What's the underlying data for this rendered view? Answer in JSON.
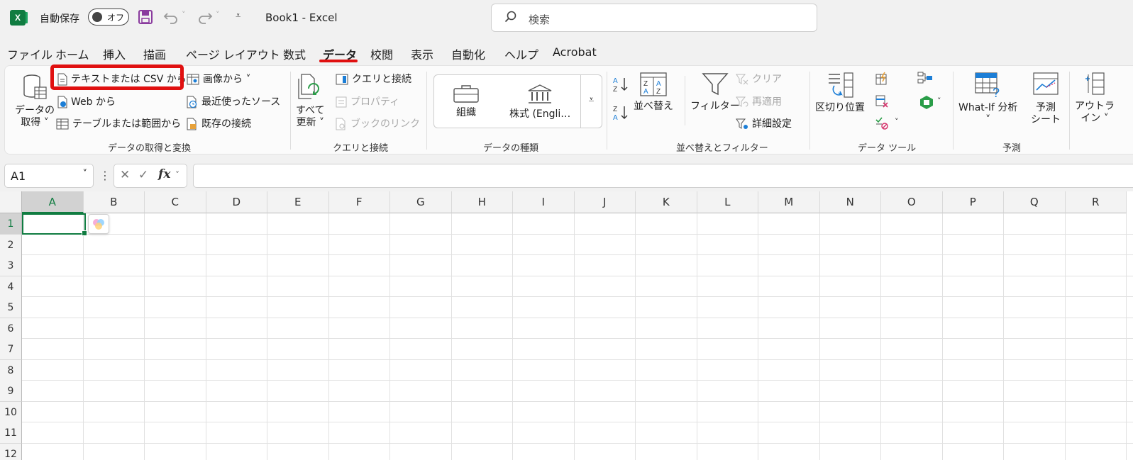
{
  "titlebar": {
    "logo": "X",
    "autosave_label": "自動保存",
    "autosave_state": "オフ",
    "doc_title": "Book1  -  Excel",
    "search_placeholder": "検索"
  },
  "menu": {
    "tabs": [
      "ファイル",
      "ホーム",
      "挿入",
      "描画",
      "ページ レイアウト",
      "数式",
      "データ",
      "校閲",
      "表示",
      "自動化",
      "ヘルプ",
      "Acrobat"
    ],
    "active": "データ"
  },
  "ribbon": {
    "get_transform": {
      "label": "データの取得と変換",
      "get_data": [
        "データの",
        "取得 ˅"
      ],
      "from_text_csv": "テキストまたは CSV から",
      "from_web": "Web から",
      "from_table": "テーブルまたは範囲から",
      "from_picture": "画像から ˅",
      "recent_sources": "最近使ったソース",
      "existing_connections": "既存の接続"
    },
    "queries": {
      "label": "クエリと接続",
      "refresh_all": [
        "すべて",
        "更新 ˅"
      ],
      "queries_connections": "クエリと接続",
      "properties": "プロパティ",
      "edit_links": "ブックのリンク"
    },
    "data_types": {
      "label": "データの種類",
      "organization": "組織",
      "stocks": "株式 (Engli…"
    },
    "sort_filter": {
      "label": "並べ替えとフィルター",
      "sort": "並べ替え",
      "filter": "フィルター",
      "clear": "クリア",
      "reapply": "再適用",
      "advanced": "詳細設定"
    },
    "data_tools": {
      "label": "データ ツール",
      "text_to_columns": "区切り位置"
    },
    "forecast": {
      "label": "予測",
      "what_if": [
        "What-If 分析",
        "˅"
      ],
      "forecast_sheet": [
        "予測",
        "シート"
      ]
    },
    "outline": {
      "label": [
        "アウトラ",
        "イン ˅"
      ]
    }
  },
  "formula_bar": {
    "name_box": "A1",
    "cancel": "✕",
    "enter": "✓",
    "fx": "fx"
  },
  "sheet": {
    "columns": [
      "A",
      "B",
      "C",
      "D",
      "E",
      "F",
      "G",
      "H",
      "I",
      "J",
      "K",
      "L",
      "M",
      "N",
      "O",
      "P",
      "Q",
      "R"
    ],
    "rows": [
      "1",
      "2",
      "3",
      "4",
      "5",
      "6",
      "7",
      "8",
      "9",
      "10",
      "11",
      "12"
    ],
    "selected_cell": "A1"
  },
  "colors": {
    "excel_green": "#107c41",
    "highlight_red": "#e01010"
  }
}
